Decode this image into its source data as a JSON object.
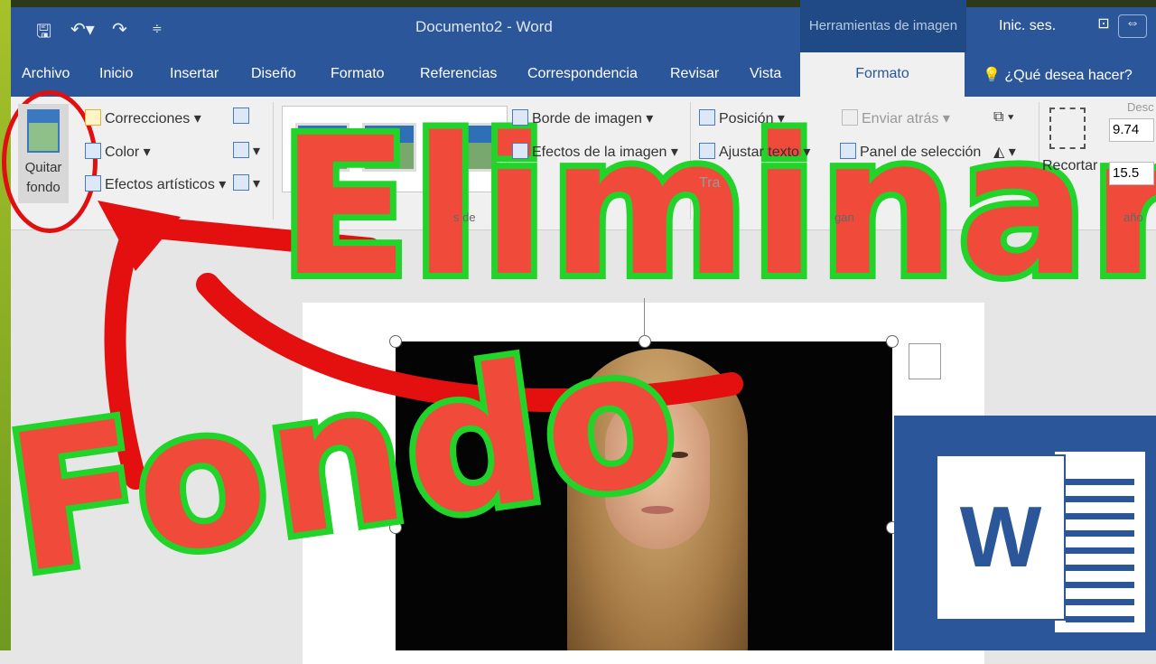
{
  "titlebar": {
    "doc_title": "Documento2 - Word",
    "context_tools": "Herramientas de imagen",
    "sign_in": "Inic. ses.",
    "icons": [
      "save-icon",
      "undo-icon",
      "redo-icon",
      "customize-icon"
    ]
  },
  "tabs": [
    "Archivo",
    "Inicio",
    "Insertar",
    "Diseño",
    "Formato",
    "Referencias",
    "Correspondencia",
    "Revisar",
    "Vista",
    "Formato"
  ],
  "tell_me": "¿Qué desea hacer?",
  "ribbon": {
    "remove_bg": [
      "Quitar",
      "fondo"
    ],
    "corrections": "Correcciones",
    "color": "Color",
    "artistic": "Efectos artísticos",
    "border": "Borde de imagen",
    "effects": "Efectos de la imagen",
    "styles_group": "s de",
    "position": "Posición",
    "wrap": "Ajustar texto",
    "transparency": "Tra",
    "send_back": "Enviar atrás",
    "selection_pane": "Panel de selección",
    "arrange_group": "gan",
    "crop": "Recortar",
    "height": "9.74",
    "width": "15.5",
    "size_group": "año",
    "desc": "Desc"
  },
  "overlay": {
    "line1": "Eliminar",
    "line2": "Fondo",
    "accent": "#f04a3a",
    "stroke": "#22d42a"
  },
  "logo": {
    "letter": "W",
    "color": "#2b579a"
  }
}
